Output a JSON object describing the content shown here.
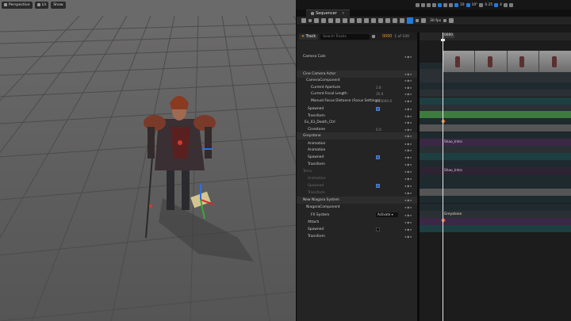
{
  "viewport": {
    "perspective_label": "Perspective",
    "lit_label": "Lit",
    "show_label": "Show"
  },
  "top_toolbar": {
    "fov_label": "10°",
    "scale_label": "0.25",
    "snap_label": "4"
  },
  "sequencer": {
    "tab_label": "Sequencer",
    "fps_label": "30 fps",
    "add_track_label": "Track",
    "search_placeholder": "Search Tracks",
    "current_frame": "0000",
    "frame_of_total": "1 of 100",
    "timeline_frame": "0000"
  },
  "tracks": [
    {
      "label": "Camera Cuts",
      "indent": 4
    },
    {
      "label": "Cine Camera Actor",
      "indent": 4
    },
    {
      "label": "CameraComponent",
      "indent": 8
    },
    {
      "label": "Current Aperture",
      "indent": 14,
      "value": "2.8"
    },
    {
      "label": "Current Focal Length",
      "indent": 14,
      "value": "35.0"
    },
    {
      "label": "Manual Focus Distance (Focus Settings)",
      "indent": 14,
      "value": "100000.0"
    },
    {
      "label": "Spawned",
      "indent": 10
    },
    {
      "label": "Transform",
      "indent": 10
    },
    {
      "label": "Ex_03_Death_Ctrl",
      "indent": 6
    },
    {
      "label": "Cinestone",
      "indent": 10,
      "value": "0.0"
    },
    {
      "label": "Greystone",
      "indent": 4
    },
    {
      "label": "Animation",
      "indent": 10
    },
    {
      "label": "Animation",
      "indent": 10
    },
    {
      "label": "Spawned",
      "indent": 10
    },
    {
      "label": "Transform",
      "indent": 10
    },
    {
      "label": "Terra",
      "indent": 4
    },
    {
      "label": "Animation",
      "indent": 10
    },
    {
      "label": "Spawned",
      "indent": 10
    },
    {
      "label": "Transform",
      "indent": 10
    },
    {
      "label": "New Niagara System",
      "indent": 4
    },
    {
      "label": "NiagaraComponent",
      "indent": 8
    },
    {
      "label": "FX System",
      "indent": 14,
      "dropdown": "Activate"
    },
    {
      "label": "Attach",
      "indent": 10
    },
    {
      "label": "Spawned",
      "indent": 10
    },
    {
      "label": "Transform",
      "indent": 10
    }
  ],
  "sections": {
    "greystone_anim": "Shao_Intro",
    "terra_anim": "Shao_Intro",
    "niagara": "Greystone"
  },
  "colors": {
    "accent": "#1f7be0",
    "frame_orange": "#e89a2a",
    "cut_track": "#3e7b3e",
    "anim_section": "#3b2746"
  }
}
